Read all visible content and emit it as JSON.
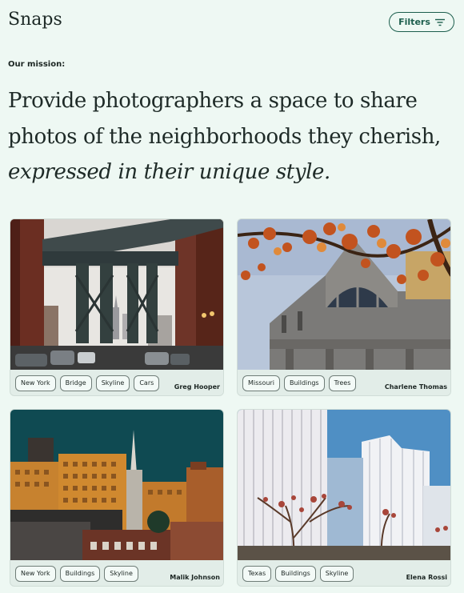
{
  "header": {
    "brand": "Snaps",
    "filters_label": "Filters",
    "filters_icon": "filter-lines-icon"
  },
  "mission": {
    "label": "Our mission:",
    "line1": "Provide photographers a space to share",
    "line2": "photos of the neighborhoods they cherish,",
    "line3": "expressed in their unique style."
  },
  "cards": [
    {
      "photographer": "Greg Hooper",
      "tags": [
        "New York",
        "Bridge",
        "Skyline",
        "Cars"
      ]
    },
    {
      "photographer": "Charlene Thomas",
      "tags": [
        "Missouri",
        "Buildings",
        "Trees"
      ]
    },
    {
      "photographer": "Malik Johnson",
      "tags": [
        "New York",
        "Buildings",
        "Skyline"
      ]
    },
    {
      "photographer": "Elena Rossi",
      "tags": [
        "Texas",
        "Buildings",
        "Skyline"
      ]
    }
  ],
  "colors": {
    "background": "#eef8f3",
    "accent": "#1c5e4d",
    "card": "#e2ede8"
  }
}
